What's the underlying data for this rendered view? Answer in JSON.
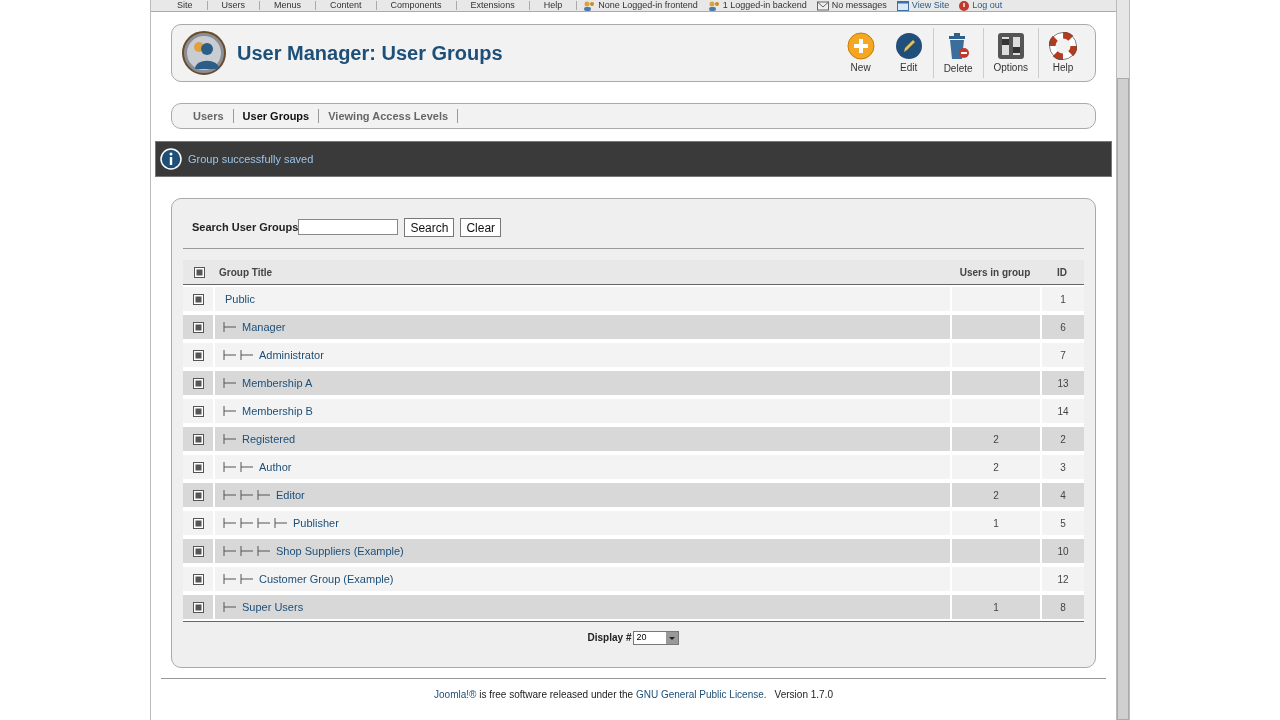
{
  "top_menu": {
    "items": [
      {
        "label": "Site"
      },
      {
        "label": "Users"
      },
      {
        "label": "Menus"
      },
      {
        "label": "Content"
      },
      {
        "label": "Components"
      },
      {
        "label": "Extensions"
      },
      {
        "label": "Help"
      }
    ],
    "status": [
      {
        "kind": "frontend",
        "label": "None Logged-in frontend"
      },
      {
        "kind": "backend",
        "label": "1 Logged-in backend"
      },
      {
        "kind": "messages",
        "label": "No messages"
      },
      {
        "kind": "site",
        "label": "View Site"
      },
      {
        "kind": "logout",
        "label": "Log out"
      }
    ]
  },
  "header": {
    "title": "User Manager: User Groups",
    "toolbar": [
      {
        "kind": "new",
        "label": "New"
      },
      {
        "kind": "edit",
        "label": "Edit"
      },
      {
        "kind": "delete",
        "label": "Delete"
      },
      {
        "kind": "options",
        "label": "Options"
      },
      {
        "kind": "help",
        "label": "Help"
      }
    ]
  },
  "submenu": [
    {
      "label": "Users",
      "selected": false
    },
    {
      "label": "User Groups",
      "selected": true
    },
    {
      "label": "Viewing Access Levels",
      "selected": false
    }
  ],
  "message": "Group successfully saved",
  "filter": {
    "label": "Search User Groups",
    "buttons": [
      "Search",
      "Clear"
    ]
  },
  "table": {
    "columns": [
      "Group Title",
      "Users in group",
      "ID"
    ],
    "all_checked": false,
    "rows": [
      {
        "title": "Public",
        "id": "1",
        "checked": false,
        "children": [
          {
            "title": "Manager",
            "id": "6",
            "checked": false,
            "children": [
              {
                "title": "Administrator",
                "id": "7",
                "checked": false
              }
            ]
          },
          {
            "title": "Membership A",
            "id": "13",
            "checked": false
          },
          {
            "title": "Membership B",
            "id": "14",
            "checked": false
          },
          {
            "title": "Registered",
            "users": "2",
            "id": "2",
            "checked": false,
            "children": [
              {
                "title": "Author",
                "users": "2",
                "id": "3",
                "checked": false,
                "children": [
                  {
                    "title": "Editor",
                    "users": "2",
                    "id": "4",
                    "checked": false,
                    "children": [
                      {
                        "title": "Publisher",
                        "users": "1",
                        "id": "5",
                        "checked": false
                      }
                    ]
                  },
                  {
                    "title": "Shop Suppliers (Example)",
                    "id": "10",
                    "checked": false
                  }
                ]
              },
              {
                "title": "Customer Group (Example)",
                "id": "12",
                "checked": false
              }
            ]
          },
          {
            "title": "Super Users",
            "users": "1",
            "id": "8",
            "checked": false
          }
        ]
      }
    ]
  },
  "pagination": {
    "label": "Display #",
    "value": "20"
  },
  "footer": {
    "link": "Joomla!®",
    "text": "is free software released under the",
    "license": "GNU General Public License.",
    "version": "Version 1.7.0"
  }
}
